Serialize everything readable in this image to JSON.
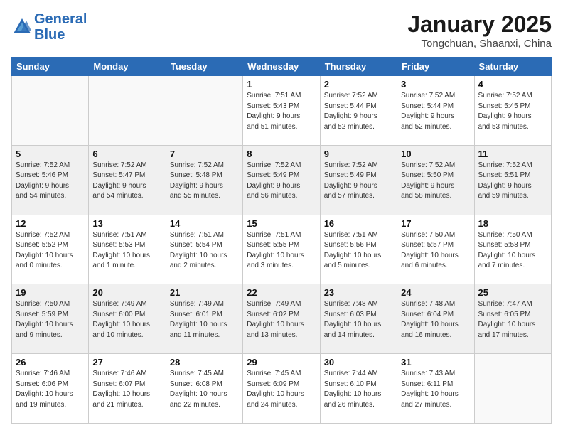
{
  "logo": {
    "line1": "General",
    "line2": "Blue"
  },
  "header": {
    "month": "January 2025",
    "location": "Tongchuan, Shaanxi, China"
  },
  "days_of_week": [
    "Sunday",
    "Monday",
    "Tuesday",
    "Wednesday",
    "Thursday",
    "Friday",
    "Saturday"
  ],
  "weeks": [
    [
      {
        "day": "",
        "detail": ""
      },
      {
        "day": "",
        "detail": ""
      },
      {
        "day": "",
        "detail": ""
      },
      {
        "day": "1",
        "detail": "Sunrise: 7:51 AM\nSunset: 5:43 PM\nDaylight: 9 hours\nand 51 minutes."
      },
      {
        "day": "2",
        "detail": "Sunrise: 7:52 AM\nSunset: 5:44 PM\nDaylight: 9 hours\nand 52 minutes."
      },
      {
        "day": "3",
        "detail": "Sunrise: 7:52 AM\nSunset: 5:44 PM\nDaylight: 9 hours\nand 52 minutes."
      },
      {
        "day": "4",
        "detail": "Sunrise: 7:52 AM\nSunset: 5:45 PM\nDaylight: 9 hours\nand 53 minutes."
      }
    ],
    [
      {
        "day": "5",
        "detail": "Sunrise: 7:52 AM\nSunset: 5:46 PM\nDaylight: 9 hours\nand 54 minutes."
      },
      {
        "day": "6",
        "detail": "Sunrise: 7:52 AM\nSunset: 5:47 PM\nDaylight: 9 hours\nand 54 minutes."
      },
      {
        "day": "7",
        "detail": "Sunrise: 7:52 AM\nSunset: 5:48 PM\nDaylight: 9 hours\nand 55 minutes."
      },
      {
        "day": "8",
        "detail": "Sunrise: 7:52 AM\nSunset: 5:49 PM\nDaylight: 9 hours\nand 56 minutes."
      },
      {
        "day": "9",
        "detail": "Sunrise: 7:52 AM\nSunset: 5:49 PM\nDaylight: 9 hours\nand 57 minutes."
      },
      {
        "day": "10",
        "detail": "Sunrise: 7:52 AM\nSunset: 5:50 PM\nDaylight: 9 hours\nand 58 minutes."
      },
      {
        "day": "11",
        "detail": "Sunrise: 7:52 AM\nSunset: 5:51 PM\nDaylight: 9 hours\nand 59 minutes."
      }
    ],
    [
      {
        "day": "12",
        "detail": "Sunrise: 7:52 AM\nSunset: 5:52 PM\nDaylight: 10 hours\nand 0 minutes."
      },
      {
        "day": "13",
        "detail": "Sunrise: 7:51 AM\nSunset: 5:53 PM\nDaylight: 10 hours\nand 1 minute."
      },
      {
        "day": "14",
        "detail": "Sunrise: 7:51 AM\nSunset: 5:54 PM\nDaylight: 10 hours\nand 2 minutes."
      },
      {
        "day": "15",
        "detail": "Sunrise: 7:51 AM\nSunset: 5:55 PM\nDaylight: 10 hours\nand 3 minutes."
      },
      {
        "day": "16",
        "detail": "Sunrise: 7:51 AM\nSunset: 5:56 PM\nDaylight: 10 hours\nand 5 minutes."
      },
      {
        "day": "17",
        "detail": "Sunrise: 7:50 AM\nSunset: 5:57 PM\nDaylight: 10 hours\nand 6 minutes."
      },
      {
        "day": "18",
        "detail": "Sunrise: 7:50 AM\nSunset: 5:58 PM\nDaylight: 10 hours\nand 7 minutes."
      }
    ],
    [
      {
        "day": "19",
        "detail": "Sunrise: 7:50 AM\nSunset: 5:59 PM\nDaylight: 10 hours\nand 9 minutes."
      },
      {
        "day": "20",
        "detail": "Sunrise: 7:49 AM\nSunset: 6:00 PM\nDaylight: 10 hours\nand 10 minutes."
      },
      {
        "day": "21",
        "detail": "Sunrise: 7:49 AM\nSunset: 6:01 PM\nDaylight: 10 hours\nand 11 minutes."
      },
      {
        "day": "22",
        "detail": "Sunrise: 7:49 AM\nSunset: 6:02 PM\nDaylight: 10 hours\nand 13 minutes."
      },
      {
        "day": "23",
        "detail": "Sunrise: 7:48 AM\nSunset: 6:03 PM\nDaylight: 10 hours\nand 14 minutes."
      },
      {
        "day": "24",
        "detail": "Sunrise: 7:48 AM\nSunset: 6:04 PM\nDaylight: 10 hours\nand 16 minutes."
      },
      {
        "day": "25",
        "detail": "Sunrise: 7:47 AM\nSunset: 6:05 PM\nDaylight: 10 hours\nand 17 minutes."
      }
    ],
    [
      {
        "day": "26",
        "detail": "Sunrise: 7:46 AM\nSunset: 6:06 PM\nDaylight: 10 hours\nand 19 minutes."
      },
      {
        "day": "27",
        "detail": "Sunrise: 7:46 AM\nSunset: 6:07 PM\nDaylight: 10 hours\nand 21 minutes."
      },
      {
        "day": "28",
        "detail": "Sunrise: 7:45 AM\nSunset: 6:08 PM\nDaylight: 10 hours\nand 22 minutes."
      },
      {
        "day": "29",
        "detail": "Sunrise: 7:45 AM\nSunset: 6:09 PM\nDaylight: 10 hours\nand 24 minutes."
      },
      {
        "day": "30",
        "detail": "Sunrise: 7:44 AM\nSunset: 6:10 PM\nDaylight: 10 hours\nand 26 minutes."
      },
      {
        "day": "31",
        "detail": "Sunrise: 7:43 AM\nSunset: 6:11 PM\nDaylight: 10 hours\nand 27 minutes."
      },
      {
        "day": "",
        "detail": ""
      }
    ]
  ]
}
